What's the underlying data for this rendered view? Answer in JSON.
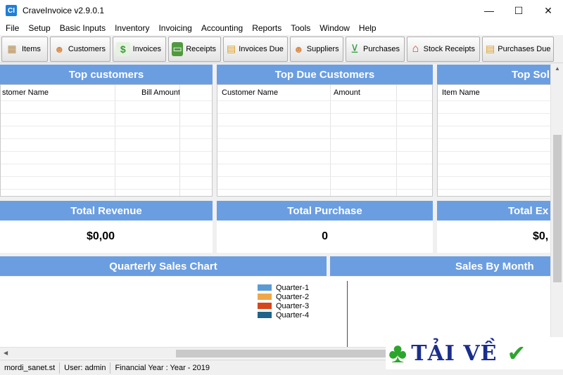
{
  "window": {
    "title": "CraveInvoice v2.9.0.1",
    "app_icon_text": "CI",
    "minimize_glyph": "—",
    "maximize_glyph": "☐",
    "close_glyph": "✕"
  },
  "menu": [
    "File",
    "Setup",
    "Basic Inputs",
    "Inventory",
    "Invoicing",
    "Accounting",
    "Reports",
    "Tools",
    "Window",
    "Help"
  ],
  "toolbar": [
    {
      "label": "Items",
      "icon": "boxes-icon",
      "glyph": "▦",
      "color": "#c9a36b"
    },
    {
      "label": "Customers",
      "icon": "person-icon",
      "glyph": "☻",
      "color": "#d98b4a"
    },
    {
      "label": "Invoices",
      "icon": "invoice-icon",
      "glyph": "$",
      "color": "#3a9a3a"
    },
    {
      "label": "Receipts",
      "icon": "cash-icon",
      "glyph": "▭",
      "color": "#4f9a3f"
    },
    {
      "label": "Invoices Due",
      "icon": "calendar-icon",
      "glyph": "▤",
      "color": "#e0a020"
    },
    {
      "label": "Suppliers",
      "icon": "supplier-icon",
      "glyph": "☻",
      "color": "#d98b4a"
    },
    {
      "label": "Purchases",
      "icon": "cart-icon",
      "glyph": "⊻",
      "color": "#3aa04a"
    },
    {
      "label": "Stock Receipts",
      "icon": "warehouse-icon",
      "glyph": "⌂",
      "color": "#c84030"
    },
    {
      "label": "Purchases Due",
      "icon": "purchase-due-icon",
      "glyph": "▤",
      "color": "#e0a020"
    }
  ],
  "panels": {
    "top_customers": {
      "title": "Top customers",
      "col1": "stomer Name",
      "col2": "Bill Amount"
    },
    "top_due_customers": {
      "title": "Top Due Customers",
      "col1": "Customer Name",
      "col2": "Amount"
    },
    "top_sold": {
      "title": "Top Sol",
      "col1": "Item Name"
    }
  },
  "totals": {
    "revenue": {
      "title": "Total Revenue",
      "value": "$0,00"
    },
    "purchase": {
      "title": "Total Purchase",
      "value": "0"
    },
    "expense": {
      "title": "Total Ex",
      "value": "$0,"
    }
  },
  "charts": {
    "quarterly": {
      "title": "Quarterly Sales Chart"
    },
    "by_month": {
      "title": "Sales By Month"
    }
  },
  "chart_data": {
    "type": "bar",
    "categories": [],
    "series": [
      {
        "name": "Quarter-1",
        "values": [],
        "color": "#5b9bd5"
      },
      {
        "name": "Quarter-2",
        "values": [],
        "color": "#f0a748"
      },
      {
        "name": "Quarter-3",
        "values": [],
        "color": "#d6471a"
      },
      {
        "name": "Quarter-4",
        "values": [],
        "color": "#1f6488"
      }
    ],
    "legend": "top-right"
  },
  "status": {
    "host": "mordi_sanet.st",
    "user": "User: admin",
    "year": "Financial Year : Year - 2019"
  },
  "watermark": {
    "text": "TẢI VỀ",
    "clover": "♣",
    "check": "✔"
  },
  "colors": {
    "panel_header": "#6b9ee0",
    "watermark_text": "#1b2e8c"
  }
}
